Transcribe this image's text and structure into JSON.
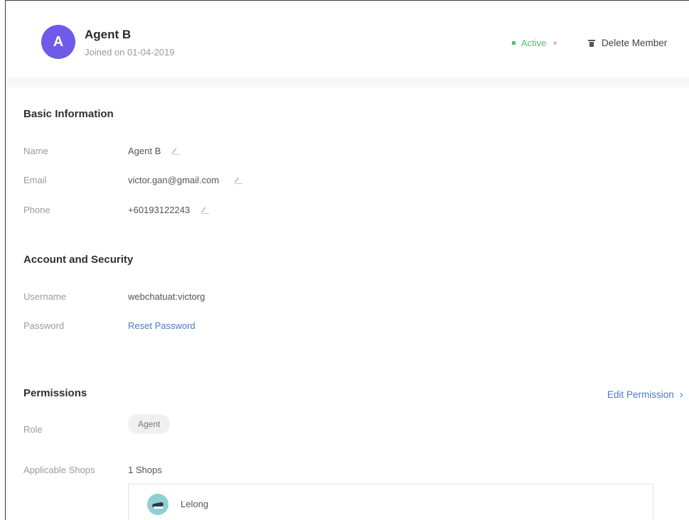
{
  "member": {
    "avatar_initial": "A",
    "name": "Agent B",
    "joined": "Joined on 01-04-2019",
    "status": "Active",
    "delete_label": "Delete Member"
  },
  "basic": {
    "title": "Basic Information",
    "name_label": "Name",
    "name_value": "Agent B",
    "email_label": "Email",
    "email_value": "victor.gan@gmail.com",
    "phone_label": "Phone",
    "phone_value": "+60193122243"
  },
  "account": {
    "title": "Account and Security",
    "username_label": "Username",
    "username_value": "webchatuat:victorg",
    "password_label": "Password",
    "reset_label": "Reset Password"
  },
  "permissions": {
    "title": "Permissions",
    "edit_label": "Edit Permission",
    "role_label": "Role",
    "role_value": "Agent",
    "shops_label": "Applicable Shops",
    "shops_count": "1 Shops",
    "shops": [
      {
        "name": "Lelong"
      }
    ]
  },
  "colors": {
    "avatar": "#6e5be8",
    "status": "#4cc46a",
    "link": "#4a78c9"
  },
  "icons": {
    "status": "status-dot-icon",
    "delete": "trash-icon",
    "edit": "pencil-icon",
    "chevron": "chevron-right-icon"
  }
}
